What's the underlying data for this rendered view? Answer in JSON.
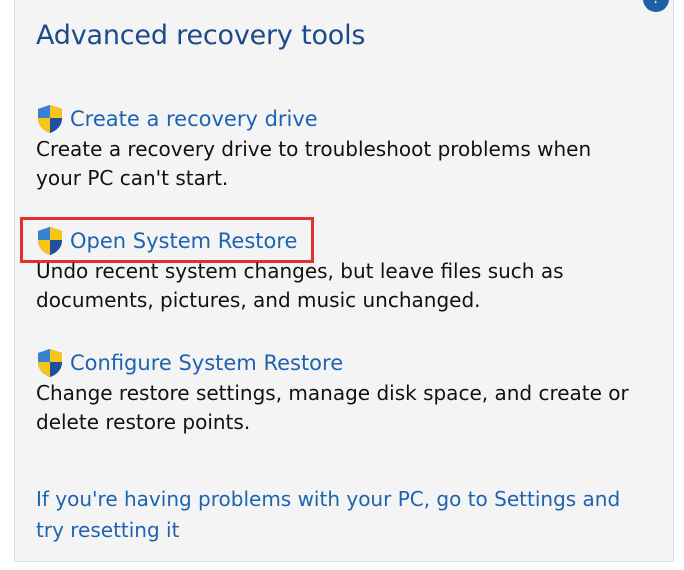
{
  "heading": "Advanced recovery tools",
  "items": [
    {
      "link": "Create a recovery drive",
      "desc_line1": "Create a recovery drive to troubleshoot problems when",
      "desc_line2": "your PC can't start."
    },
    {
      "link": "Open System Restore",
      "desc_line1": "Undo recent system changes, but leave files such as",
      "desc_line2": "documents, pictures, and music unchanged."
    },
    {
      "link": "Configure System Restore",
      "desc_line1": "Change restore settings, manage disk space, and create or",
      "desc_line2": "delete restore points."
    }
  ],
  "footer": {
    "line1": "If you're having problems with your PC, go to Settings and",
    "line2": "try resetting it"
  },
  "colors": {
    "heading": "#1e4a8c",
    "link": "#1d63b0",
    "highlight": "#e0312f",
    "panel_bg": "#f4f4f4"
  },
  "icons": {
    "uac_shield": "shield-icon",
    "help": "help-icon"
  }
}
